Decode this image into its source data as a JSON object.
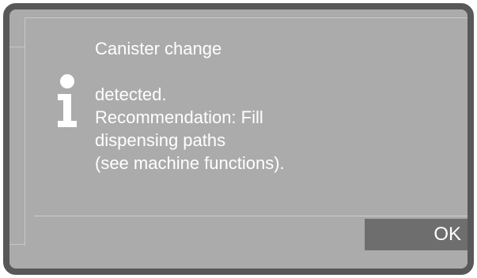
{
  "dialog": {
    "title": "Canister change",
    "message_lines": [
      "detected.",
      "Recommendation: Fill",
      "dispensing paths",
      "(see machine functions)."
    ],
    "ok_label": "OK",
    "icon": "info-icon"
  },
  "colors": {
    "bezel": "#585858",
    "screen_background": "#ababab",
    "text": "#ffffff",
    "ok_button": "#6e6e6e"
  }
}
